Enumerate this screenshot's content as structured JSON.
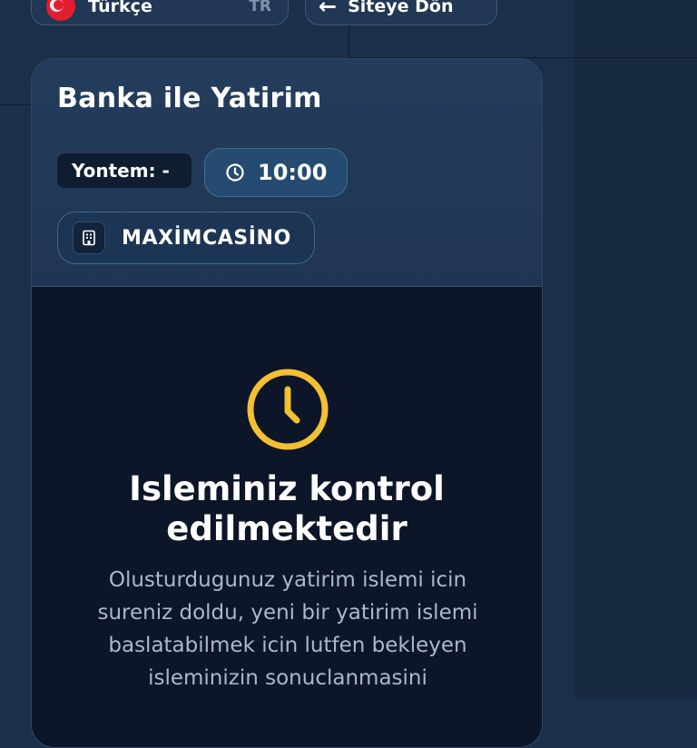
{
  "topbar": {
    "language_label": "Türkçe",
    "language_code": "TR",
    "back_label": "Siteye Dön"
  },
  "card": {
    "title": "Banka ile Yatirim",
    "method_label": "Yontem: -",
    "timer": "10:00",
    "site_name": "MAXİMCASİNO"
  },
  "status": {
    "title_line1": "Isleminiz kontrol",
    "title_line2": "edilmektedir",
    "desc_line1": "Olusturdugunuz yatirim islemi icin",
    "desc_line2": "sureniz doldu, yeni bir yatirim islemi",
    "desc_line3": "baslatabilmek icin lutfen bekleyen",
    "desc_line4": "isleminizin sonuclanmasini"
  },
  "colors": {
    "accent": "#f3c033",
    "background": "#1c2f48",
    "card_body": "#0c1628"
  },
  "icons": [
    "turkey-flag-icon",
    "arrow-left-icon",
    "clock-icon",
    "building-icon",
    "clock-large-icon"
  ]
}
